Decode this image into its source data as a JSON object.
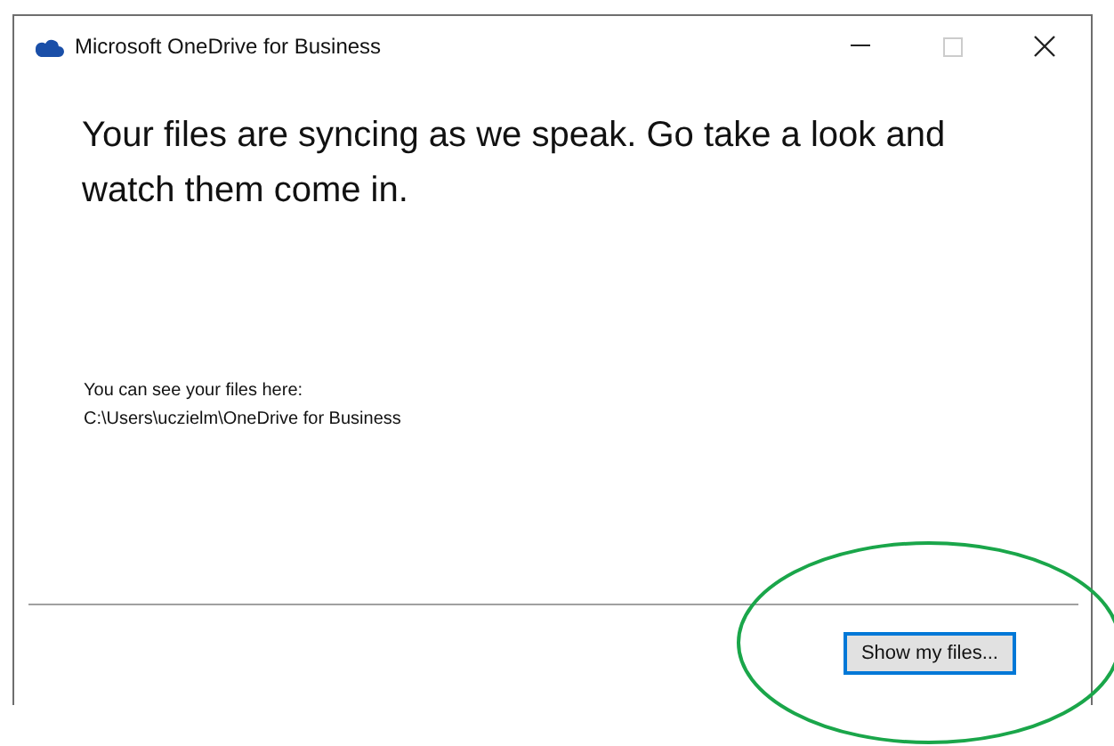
{
  "window": {
    "title": "Microsoft OneDrive for Business",
    "controls": [
      {
        "kind": "minimize",
        "disabled": false
      },
      {
        "kind": "maximize",
        "disabled": true
      },
      {
        "kind": "close",
        "disabled": false
      }
    ]
  },
  "heading": "Your files are syncing as we speak. Go take a look and watch them come in.",
  "location_label": "You can see your files here:",
  "location_path": "C:\\Users\\uczielm\\OneDrive for Business",
  "button": {
    "label": "Show my files...",
    "focused": true
  }
}
